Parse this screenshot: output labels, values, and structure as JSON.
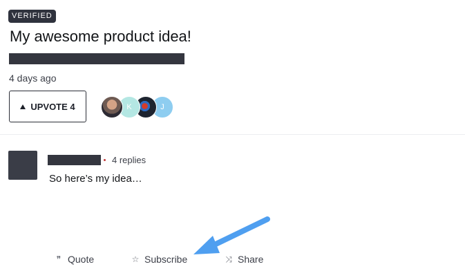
{
  "post": {
    "badge": "VERIFIED",
    "title": "My awesome product idea!",
    "timestamp": "4 days ago",
    "upvote_label": "UPVOTE 4",
    "voters": [
      {
        "initial": "",
        "color": "#6e5a52"
      },
      {
        "initial": "K",
        "color": "#b4e7e3"
      },
      {
        "initial": "",
        "color": "#2e6bc2"
      },
      {
        "initial": "J",
        "color": "#8ecdf0"
      }
    ]
  },
  "reply": {
    "count_label": "4 replies",
    "text": "So here’s my idea…"
  },
  "actions": {
    "quote_label": "Quote",
    "subscribe_label": "Subscribe",
    "share_label": "Share",
    "quote_icon": "quote-icon",
    "subscribe_icon": "star-icon",
    "share_icon": "shuffle-icon"
  },
  "colors": {
    "annotation_arrow": "#4f9ff0",
    "redaction": "#34363f",
    "badge_bg": "#2f323d"
  }
}
